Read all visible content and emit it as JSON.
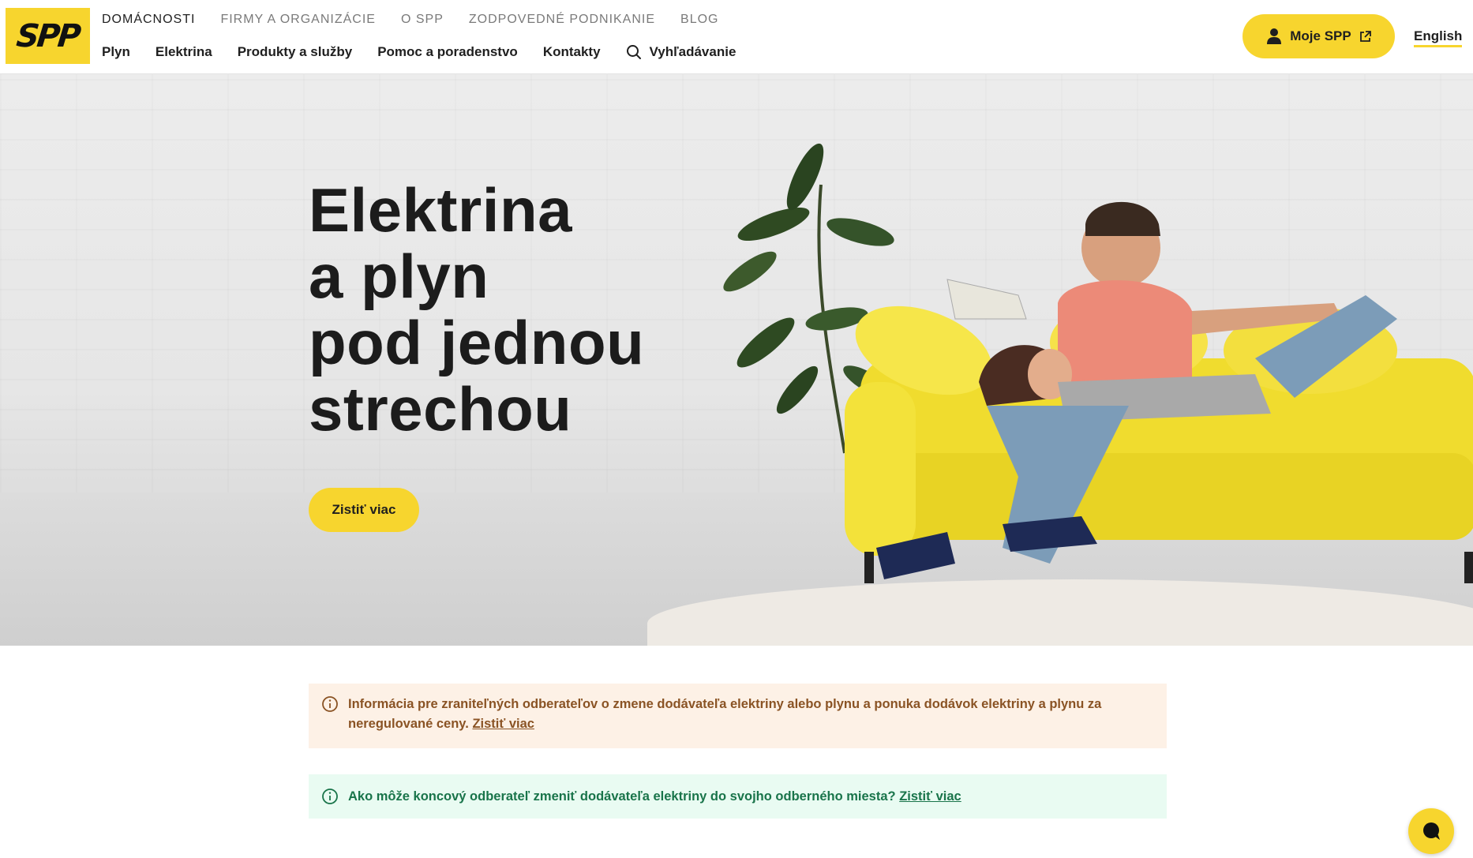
{
  "brand": {
    "logo_text": "SPP",
    "accent": "#f7d52e"
  },
  "top_nav": [
    "DOMÁCNOSTI",
    "FIRMY A ORGANIZÁCIE",
    "O SPP",
    "ZODPOVEDNÉ PODNIKANIE",
    "BLOG"
  ],
  "main_nav": [
    "Plyn",
    "Elektrina",
    "Produkty a služby",
    "Pomoc a poradenstvo",
    "Kontakty"
  ],
  "search": {
    "label": "Vyhľadávanie",
    "icon": "search-icon"
  },
  "account": {
    "label": "Moje SPP",
    "icons": [
      "user-icon",
      "external-link-icon"
    ]
  },
  "language": {
    "label": "English"
  },
  "hero": {
    "title_lines": [
      "Elektrina",
      "a plyn",
      "pod jednou",
      "strechou"
    ],
    "cta": "Zistiť viac"
  },
  "notices": [
    {
      "text": "Informácia pre zraniteľných odberateľov o zmene dodávateľa elektriny alebo plynu a ponuka dodávok elektriny a plynu za neregulované ceny.",
      "link": "Zistiť viac",
      "bg": "#fdf1e6",
      "color": "#8a5324"
    },
    {
      "text": "Ako môže koncový odberateľ zmeniť dodávateľa elektriny do svojho odberného miesta?",
      "link": "Zistiť viac",
      "bg": "#e9fbf2",
      "color": "#19744a"
    }
  ],
  "chat": {
    "icon": "chat-bubble-icon"
  }
}
